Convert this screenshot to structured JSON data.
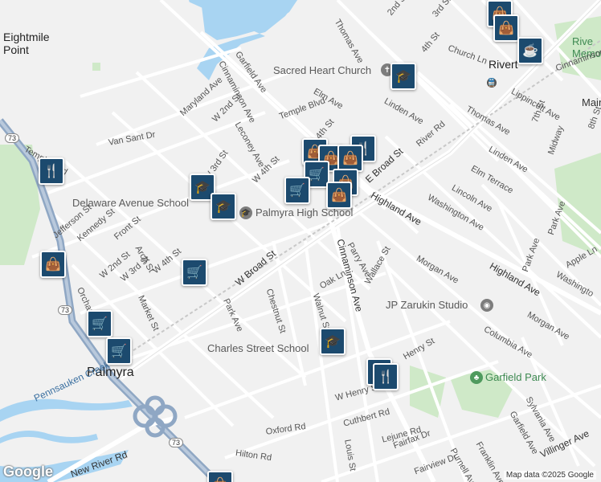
{
  "map": {
    "attribution": "Map data ©2025 Google",
    "logo": "Google",
    "places": [
      {
        "id": "eightmile",
        "text": "Eightmile\nPoint"
      },
      {
        "id": "palmyra",
        "text": "Palmyra"
      },
      {
        "id": "riverton",
        "text": "Rivert"
      },
      {
        "id": "memorial",
        "text": "Rive\nMemori"
      }
    ],
    "pois": [
      {
        "id": "sacred",
        "text": "Sacred Heart Church",
        "icon": "church-icon"
      },
      {
        "id": "delaware",
        "text": "Delaware Avenue School",
        "icon": "school-icon"
      },
      {
        "id": "palmyrahigh",
        "text": "Palmyra High School",
        "icon": "school-icon"
      },
      {
        "id": "charles",
        "text": "Charles Street School",
        "icon": "school-icon"
      },
      {
        "id": "zarukin",
        "text": "JP Zarukin Studio",
        "icon": "camera-icon"
      },
      {
        "id": "garfieldpark",
        "text": "Garfield Park",
        "icon": "tree-icon"
      }
    ],
    "roads": [
      {
        "text": "Thomas Ave"
      },
      {
        "text": "2nd St"
      },
      {
        "text": "3rd St"
      },
      {
        "text": "4th St"
      },
      {
        "text": "Church Ln"
      },
      {
        "text": "Garfield Ave"
      },
      {
        "text": "Cinnaminson Ave"
      },
      {
        "text": "Maryland Ave"
      },
      {
        "text": "W 2nd St"
      },
      {
        "text": "Temple Blvd"
      },
      {
        "text": "Elm Ave"
      },
      {
        "text": "Linden Ave"
      },
      {
        "text": "River Rd"
      },
      {
        "text": "Van Sant Dr"
      },
      {
        "text": "Leconey Ave"
      },
      {
        "text": "W 3rd St"
      },
      {
        "text": "W 4th St"
      },
      {
        "text": "E 4th St"
      },
      {
        "text": "E Broad St"
      },
      {
        "text": "Thomas Ave"
      },
      {
        "text": "Lippincott Ave"
      },
      {
        "text": "7th St"
      },
      {
        "text": "Midway"
      },
      {
        "text": "Linden Ave"
      },
      {
        "text": "Elm Terrace"
      },
      {
        "text": "Lincoln Ave"
      },
      {
        "text": "Washington Ave"
      },
      {
        "text": "Highland Ave"
      },
      {
        "text": "Jefferson St"
      },
      {
        "text": "Kennedy St"
      },
      {
        "text": "Front St"
      },
      {
        "text": "W 2nd St"
      },
      {
        "text": "Arch St"
      },
      {
        "text": "W 3rd St"
      },
      {
        "text": "W 4th St"
      },
      {
        "text": "W Broad St"
      },
      {
        "text": "Parry Ave"
      },
      {
        "text": "Wallace St"
      },
      {
        "text": "Morgan Ave"
      },
      {
        "text": "Park Ave"
      },
      {
        "text": "Apple Ln"
      },
      {
        "text": "Washingto"
      },
      {
        "text": "Highland Ave"
      },
      {
        "text": "Oak Ln"
      },
      {
        "text": "Chestnut St"
      },
      {
        "text": "Orchard"
      },
      {
        "text": "Market St"
      },
      {
        "text": "Park Ave"
      },
      {
        "text": "Walnut St"
      },
      {
        "text": "Cinnaminson Ave"
      },
      {
        "text": "Morgan Ave"
      },
      {
        "text": "Columbia Ave"
      },
      {
        "text": "Henry St"
      },
      {
        "text": "W Henry St"
      },
      {
        "text": "Cuthbert Rd"
      },
      {
        "text": "Lejune Rd"
      },
      {
        "text": "Sylvania Ave"
      },
      {
        "text": "Garfield Ave"
      },
      {
        "text": "Villinger Ave"
      },
      {
        "text": "Oxford Rd"
      },
      {
        "text": "Fairfax Dr"
      },
      {
        "text": "Louis St"
      },
      {
        "text": "Franklin Ave"
      },
      {
        "text": "Purnell Ave"
      },
      {
        "text": "Hilton Rd"
      },
      {
        "text": "Pennsauken Creek"
      },
      {
        "text": "New River Rd"
      },
      {
        "text": "Temple Blvd"
      },
      {
        "text": "Fairview Dr"
      },
      {
        "text": "Main"
      },
      {
        "text": "8th St"
      },
      {
        "text": "Cinnaminson St"
      },
      {
        "text": "Park Ave"
      },
      {
        "text": "73"
      },
      {
        "text": "73"
      },
      {
        "text": "73"
      }
    ],
    "colors": {
      "water": "#a8d4f2",
      "park": "#cfe9c8",
      "road": "#ffffff",
      "highway": "#8fa7c4",
      "pin": "#1c4a6e",
      "land": "#f1f1f1"
    }
  }
}
